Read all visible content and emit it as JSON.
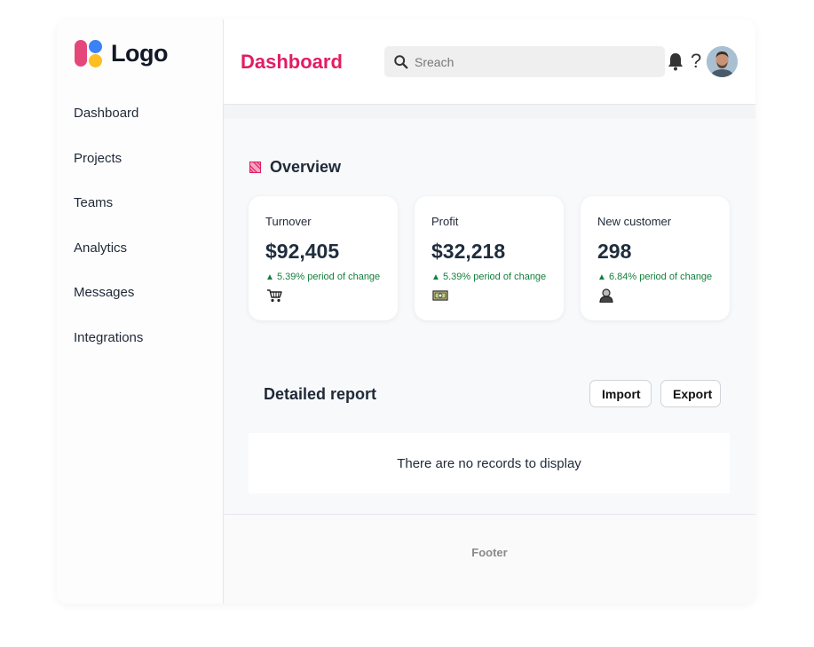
{
  "logo": {
    "text": "Logo"
  },
  "sidebar": {
    "items": [
      {
        "label": "Dashboard"
      },
      {
        "label": "Projects"
      },
      {
        "label": "Teams"
      },
      {
        "label": "Analytics"
      },
      {
        "label": "Messages"
      },
      {
        "label": "Integrations"
      }
    ]
  },
  "header": {
    "title": "Dashboard",
    "search_placeholder": "Sreach",
    "help_label": "?",
    "icons": [
      "search-icon",
      "bell-icon",
      "help-icon",
      "avatar"
    ]
  },
  "overview": {
    "title": "Overview",
    "icon": "overview-icon",
    "cards": [
      {
        "label": "Turnover",
        "value": "$92,405",
        "change": "5.39% period of change",
        "icon": "shopping-cart-icon"
      },
      {
        "label": "Profit",
        "value": "$32,218",
        "change": "5.39% period of change",
        "icon": "money-icon"
      },
      {
        "label": "New customer",
        "value": "298",
        "change": "6.84% period of change",
        "icon": "user-icon"
      }
    ]
  },
  "report": {
    "title": "Detailed report",
    "import_label": "Import",
    "export_label": "Export",
    "empty_text": "There are no records to display"
  },
  "footer": {
    "text": "Footer"
  },
  "colors": {
    "accent": "#e11d63",
    "positive": "#15803d",
    "logo_pink": "#e6477a",
    "logo_blue": "#3b82f6",
    "logo_yellow": "#fbbf24"
  }
}
